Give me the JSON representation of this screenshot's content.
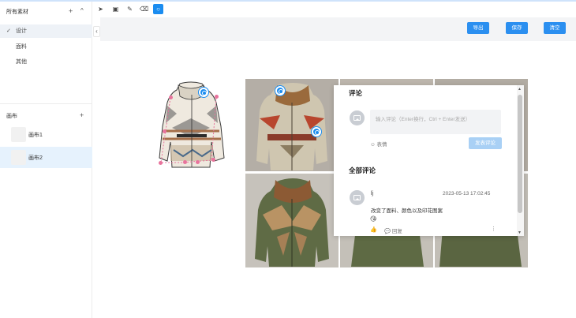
{
  "sidebar": {
    "materials_title": "所有素材",
    "plus_icon": "+",
    "collapse_icon": "^",
    "tree": [
      {
        "label": "设计",
        "check": "✓"
      },
      {
        "label": "面料"
      },
      {
        "label": "其他"
      }
    ],
    "canvas_title": "画布",
    "canvas_plus": "+",
    "canvases": [
      {
        "label": "画布1"
      },
      {
        "label": "画布2"
      }
    ]
  },
  "collapse_glyph": "‹",
  "toolbar": {
    "tools": [
      {
        "name": "pointer-tool",
        "glyph": "➤"
      },
      {
        "name": "image-tool",
        "glyph": "▣"
      },
      {
        "name": "pen-tool",
        "glyph": "✎"
      },
      {
        "name": "eraser-tool",
        "glyph": "⌫"
      },
      {
        "name": "lasso-tool",
        "glyph": "○"
      }
    ]
  },
  "header": {
    "export_label": "导出",
    "save_label": "保存",
    "clear_label": "清空"
  },
  "comments": {
    "title": "评论",
    "input_placeholder": "输入评论（Enter换行，Ctrl + Enter发送）",
    "emoji_label": "表情",
    "emoji_icon": "☺",
    "send_label": "发表评论",
    "all_title": "全部评论",
    "items": [
      {
        "user": "lj",
        "time": "2023-05-13 17:02:45",
        "text": "改变了面料、颜色以及印花图案",
        "emoji": "😘",
        "like_icon": "👍",
        "reply_label": "回复",
        "reply_icon": "💬",
        "more_icon": "⋮"
      }
    ]
  },
  "scroll": {
    "up": "▲",
    "down": "▼"
  },
  "colors": {
    "accent": "#2b8ff0",
    "marker": "#1a8cf0",
    "lasso": "#e8739c",
    "selected_bg": "#e6f2fd"
  }
}
